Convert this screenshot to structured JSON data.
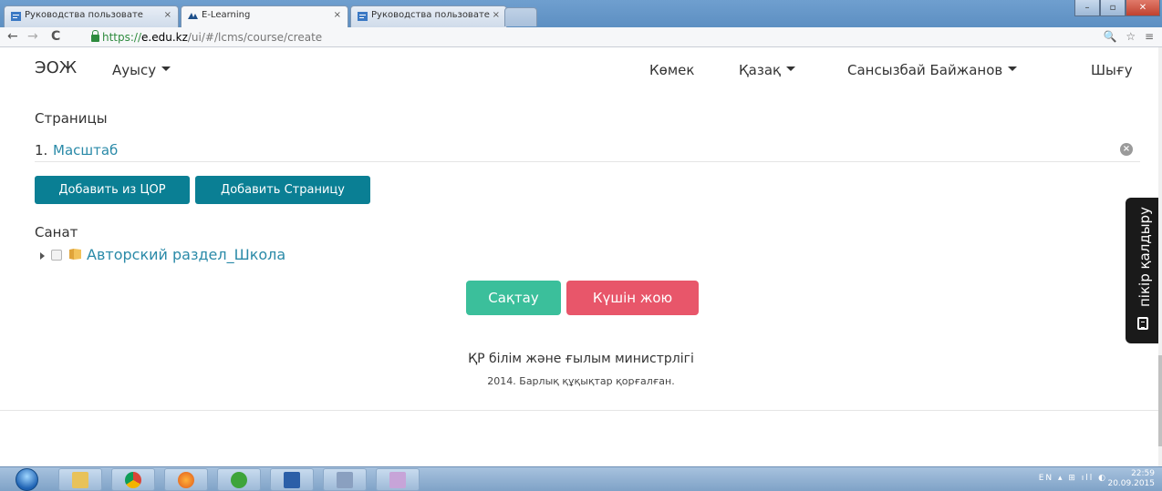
{
  "browser": {
    "tabs": [
      {
        "title": "Руководства пользовате",
        "active": false
      },
      {
        "title": "E-Learning",
        "active": true
      },
      {
        "title": "Руководства пользовате",
        "active": false
      }
    ],
    "tab_close": "×",
    "url_secure": "https://",
    "url_host": "e.edu.kz",
    "url_path": "/ui/#/lcms/course/create"
  },
  "navbar": {
    "brand": "ЭОЖ",
    "menu_transition": "Ауысу",
    "help": "Көмек",
    "language": "Қазақ",
    "user": "Сансызбай Байжанов",
    "logout": "Шығу"
  },
  "pages": {
    "heading": "Страницы",
    "items": [
      {
        "number": "1.",
        "title": "Масштаб"
      }
    ],
    "remove_glyph": "×",
    "add_from_cor": "Добавить из ЦОР",
    "add_page": "Добавить Страницу"
  },
  "category": {
    "heading": "Санат",
    "tree_item": "Авторский раздел_Школа"
  },
  "actions": {
    "save": "Сақтау",
    "delete": "Күшін жою"
  },
  "footer": {
    "ministry": "ҚР білім және ғылым министрлігі",
    "copyright": "2014. Барлық құқықтар қорғалған."
  },
  "feedback": {
    "label": "пікір қалдыру"
  },
  "taskbar": {
    "tray_lang": "EN",
    "time": "22:59",
    "date": "20.09.2015"
  },
  "colors": {
    "teal_button": "#0a7f94",
    "save_button": "#3bbf9b",
    "delete_button": "#e8566a",
    "link": "#2a8aa8"
  }
}
